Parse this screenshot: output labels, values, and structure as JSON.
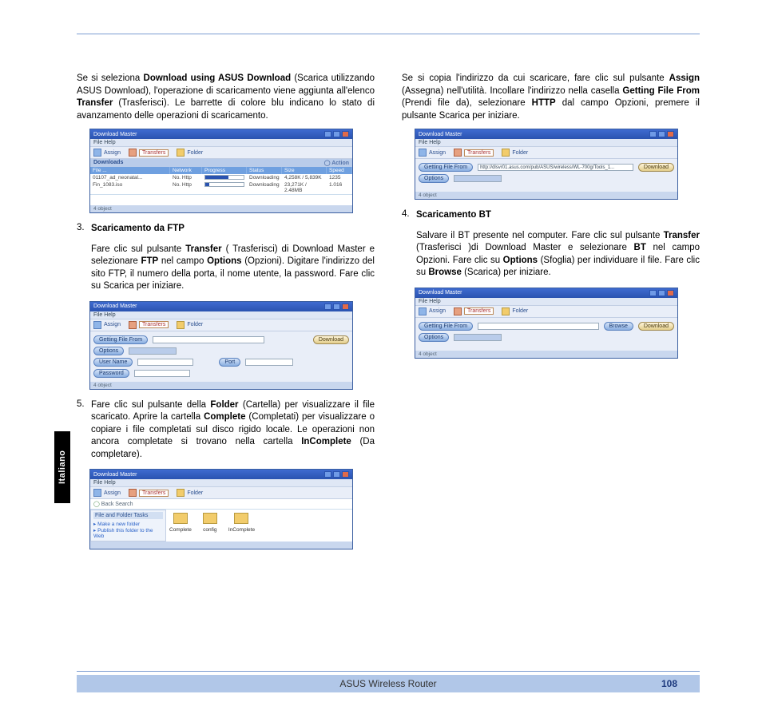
{
  "language_tab": "Italiano",
  "footer": {
    "title": "ASUS Wireless Router",
    "page": "108"
  },
  "left": {
    "para1": {
      "pre1": "Se si seleziona ",
      "b1": "Download using ASUS Download",
      "pre2": " (Scarica utilizzando ASUS Download), l'operazione di scaricamento viene aggiunta all'elenco ",
      "b2": "Transfer",
      "post": " (Trasferisci). Le barrette di colore blu indicano lo stato di avanzamento delle operazioni di scaricamento."
    },
    "win1": {
      "title": "Download Master",
      "menu": "File   Help",
      "tb_assign": "Assign",
      "tb_transfers": "Transfers",
      "tb_folder": "Folder",
      "action": "Action",
      "section": "Downloads",
      "hdr": [
        "File ...",
        "Network",
        "Progress",
        "Status",
        "Size",
        "Speed"
      ],
      "rows": [
        {
          "file": "01107_ad_neonatal...",
          "net": "No. Http",
          "prog": 60,
          "status": "Downloading",
          "size": "4,258K / 5,839K",
          "speed": "1235"
        },
        {
          "file": "Fin_1083.iso",
          "net": "No. Http",
          "prog": 10,
          "status": "Downloading",
          "size": "23,271K / 2.48MB",
          "speed": "1.016"
        }
      ],
      "status": "4 object"
    },
    "item3": {
      "num": "3.",
      "title": "Scaricamento da FTP",
      "body_pre": "Fare clic sul pulsante ",
      "b1": "Transfer",
      "mid1": " ( Trasferisci) di Download Master e selezionare ",
      "b2": "FTP",
      "mid2": " nel campo ",
      "b3": "Options",
      "post": " (Opzioni). Digitare l'indirizzo del sito FTP, il numero della porta, il nome utente, la password. Fare clic su Scarica per iniziare."
    },
    "win3": {
      "title": "Download Master",
      "menu": "File   Help",
      "tb_assign": "Assign",
      "tb_transfers": "Transfers",
      "tb_folder": "Folder",
      "btn_getfile": "Getting File From",
      "btn_download": "Download",
      "btn_options": "Options",
      "btn_user": "User Name",
      "btn_port": "Port",
      "btn_pass": "Password",
      "status": "4 object"
    },
    "item5": {
      "num": "5.",
      "body_pre": "Fare clic sul pulsante della ",
      "b1": "Folder",
      "mid1": " (Cartella) per visualizzare il file scaricato. Aprire la cartella ",
      "b2": "Complete",
      "mid2": " (Completati) per visualizzare o copiare i file completati sul disco rigido locale. Le operazioni non ancora completate si trovano nella cartella ",
      "b3": "InComplete",
      "post": " (Da completare)."
    },
    "win5": {
      "title": "Download Master",
      "menu": "File   Help",
      "tb_assign": "Assign",
      "tb_transfers": "Transfers",
      "tb_folder": "Folder",
      "nav": "Back    Search",
      "tasks_hdr": "File and Folder Tasks",
      "task1": "Make a new folder",
      "task2": "Publish this folder to the Web",
      "fld": [
        "Complete",
        "config",
        "InComplete"
      ]
    }
  },
  "right": {
    "para1": {
      "pre1": "Se si copia l'indirizzo da cui scaricare, fare clic sul pulsante ",
      "b1": "Assign",
      "mid1": " (Assegna) nell'utilità. Incollare l'indirizzo nella casella ",
      "b2": "Getting File From",
      "mid2": " (Prendi file da), selezionare ",
      "b3": "HTTP",
      "post": " dal campo Opzioni, premere il pulsante Scarica per iniziare."
    },
    "win2": {
      "title": "Download Master",
      "menu": "File   Help",
      "tb_assign": "Assign",
      "tb_transfers": "Transfers",
      "tb_folder": "Folder",
      "btn_getfile": "Getting File From",
      "url": "http://dlsvr01.asus.com/pub/ASUS/wireless/WL-700g/Tools_1...",
      "btn_download": "Download",
      "btn_options": "Options",
      "status": "4 object"
    },
    "item4": {
      "num": "4.",
      "title": "Scaricamento BT",
      "body_pre": "Salvare il BT presente nel computer. Fare clic sul pulsante ",
      "b1": "Transfer",
      "mid1": " (Trasferisci )di Download Master e selezionare ",
      "b2": "BT",
      "mid2": " nel campo Opzioni. Fare clic su ",
      "b3": "Options",
      "mid3": " (Sfoglia) per individuare il file. Fare clic su ",
      "b4": "Browse",
      "post": " (Scarica) per iniziare."
    },
    "win4": {
      "title": "Download Master",
      "menu": "File   Help",
      "tb_assign": "Assign",
      "tb_transfers": "Transfers",
      "tb_folder": "Folder",
      "btn_getfile": "Getting File From",
      "btn_browse": "Browse",
      "btn_download": "Download",
      "btn_options": "Options",
      "status": "4 object"
    }
  }
}
